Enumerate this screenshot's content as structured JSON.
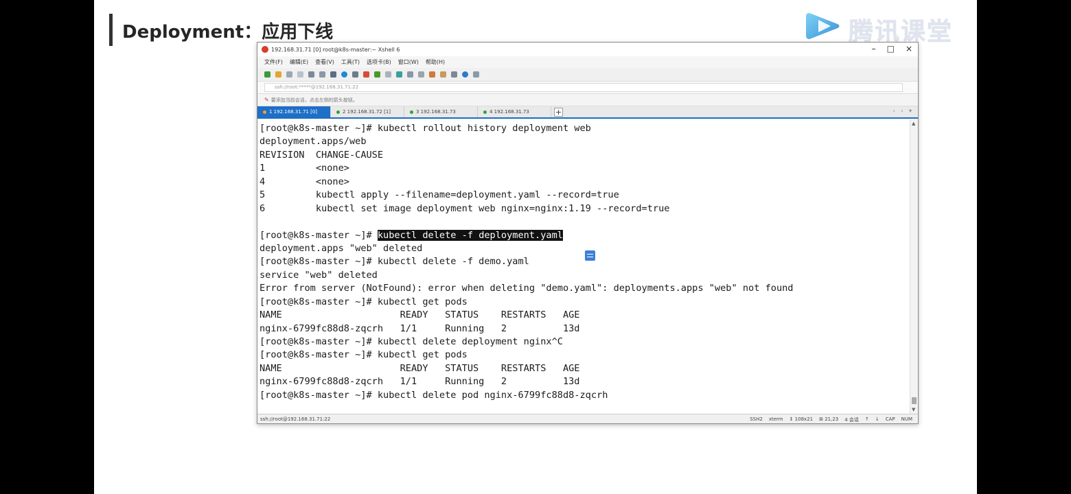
{
  "slide": {
    "title": "Deployment：应用下线"
  },
  "logo": {
    "text": "腾讯课堂"
  },
  "window": {
    "title": "192.168.31.71 [0]    root@k8s-master:~    Xshell 6",
    "controls": [
      "–",
      "□",
      "×"
    ]
  },
  "menu": [
    "文件(F)",
    "编辑(E)",
    "查看(V)",
    "工具(T)",
    "选项卡(B)",
    "窗口(W)",
    "帮助(H)"
  ],
  "address": "ssh://root:*****@192.168.31.71:22",
  "session_hint": "要添加当前会话，点击左侧的箭头按钮。",
  "tabs": [
    {
      "label": "1 192.168.31.71 [0]",
      "active": true
    },
    {
      "label": "2 192.168.31.72 [1]",
      "active": false
    },
    {
      "label": "3 192.168.31.73",
      "active": false
    },
    {
      "label": "4 192.168.31.73",
      "active": false
    }
  ],
  "tab_add": "+",
  "tab_nav": "‹ › ▾",
  "terminal": {
    "lines": [
      "[root@k8s-master ~]# kubectl rollout history deployment web",
      "deployment.apps/web",
      "REVISION  CHANGE-CAUSE",
      "1         <none>",
      "4         <none>",
      "5         kubectl apply --filename=deployment.yaml --record=true",
      "6         kubectl set image deployment web nginx=nginx:1.19 --record=true",
      "",
      "[root@k8s-master ~]# ",
      "deployment.apps \"web\" deleted",
      "[root@k8s-master ~]# kubectl delete -f demo.yaml",
      "service \"web\" deleted",
      "Error from server (NotFound): error when deleting \"demo.yaml\": deployments.apps \"web\" not found",
      "[root@k8s-master ~]# kubectl get pods",
      "NAME                     READY   STATUS    RESTARTS   AGE",
      "nginx-6799fc88d8-zqcrh   1/1     Running   2          13d",
      "[root@k8s-master ~]# kubectl delete deployment nginx^C",
      "[root@k8s-master ~]# kubectl get pods",
      "NAME                     READY   STATUS    RESTARTS   AGE",
      "nginx-6799fc88d8-zqcrh   1/1     Running   2          13d",
      "[root@k8s-master ~]# kubectl delete pod nginx-6799fc88d8-zqcrh"
    ],
    "highlighted_command": "kubectl delete -f deployment.yaml"
  },
  "status": {
    "left": "ssh://root@192.168.31.71:22",
    "right": [
      "SSH2",
      "xterm",
      "↕ 108x21",
      "⊞ 21,23",
      "4 会话",
      "↑",
      "↓",
      "CAP",
      "NUM"
    ]
  },
  "colors": {
    "tab_active": "#1e6fc7",
    "terminal_bg": "#ffffff",
    "terminal_fg": "#1a1a1a",
    "logo_text": "#dfe4ee"
  }
}
